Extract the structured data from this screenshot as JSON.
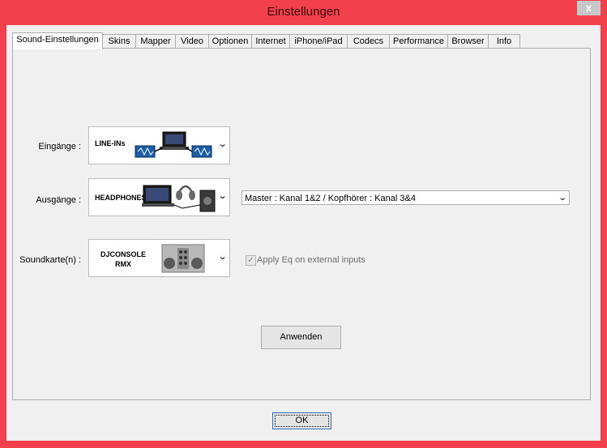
{
  "window": {
    "title": "Einstellungen",
    "close_label": "x"
  },
  "tabs": [
    {
      "label": "Sound-Einstellungen"
    },
    {
      "label": "Skins"
    },
    {
      "label": "Mapper"
    },
    {
      "label": "Video"
    },
    {
      "label": "Optionen"
    },
    {
      "label": "Internet"
    },
    {
      "label": "iPhone/iPad"
    },
    {
      "label": "Codecs"
    },
    {
      "label": "Performance"
    },
    {
      "label": "Browser"
    },
    {
      "label": "Info"
    }
  ],
  "inputs": {
    "label": "Eingänge :",
    "value": "LINE-INs"
  },
  "outputs": {
    "label": "Ausgänge :",
    "value": "HEADPHONES",
    "mode": "Master : Kanal 1&2 / Kopfhörer : Kanal 3&4"
  },
  "soundcard": {
    "label": "Soundkarte(n) :",
    "value": "DJCONSOLE RMX"
  },
  "apply_eq": {
    "label": "Apply Eq on external inputs",
    "checked": true
  },
  "apply_button": "Anwenden",
  "ok_button": "OK"
}
